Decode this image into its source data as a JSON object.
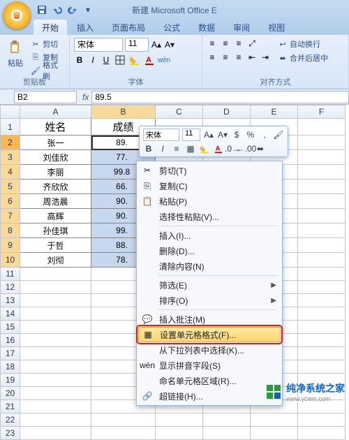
{
  "title": "新建 Microsoft Office E",
  "qat": {
    "save": "保存",
    "undo": "撤销",
    "redo": "重做"
  },
  "tabs": [
    "开始",
    "插入",
    "页面布局",
    "公式",
    "数据",
    "审阅",
    "视图"
  ],
  "active_tab_index": 0,
  "ribbon": {
    "clipboard": {
      "label": "剪贴板",
      "paste": "粘贴",
      "cut": "剪切",
      "copy": "复制",
      "format_painter": "格式刷"
    },
    "font": {
      "label": "字体",
      "name": "宋体",
      "size": "11"
    },
    "align": {
      "label": "对齐方式",
      "wrap": "自动换行",
      "merge": "合并后居中"
    }
  },
  "namebox": "B2",
  "formula": "89.5",
  "columns": [
    "A",
    "B",
    "C",
    "D",
    "E",
    "F"
  ],
  "row_headers": [
    1,
    2,
    3,
    4,
    5,
    6,
    7,
    8,
    9,
    10,
    11,
    12,
    13,
    14,
    15,
    16,
    17,
    18,
    19,
    20,
    21,
    22,
    23
  ],
  "header_row": {
    "A": "姓名",
    "B": "成绩"
  },
  "rows": [
    {
      "A": "张一",
      "B": "89."
    },
    {
      "A": "刘佳欣",
      "B": "77."
    },
    {
      "A": "李丽",
      "B": "99.8"
    },
    {
      "A": "齐欣欣",
      "B": "66."
    },
    {
      "A": "周浩晨",
      "B": "90."
    },
    {
      "A": "高辉",
      "B": "90."
    },
    {
      "A": "孙佳琪",
      "B": "99."
    },
    {
      "A": "于哲",
      "B": "88."
    },
    {
      "A": "刘彻",
      "B": "78."
    }
  ],
  "mini_toolbar": {
    "font": "宋体",
    "size": "11"
  },
  "context_menu": [
    {
      "icon": "scissors",
      "label": "剪切(T)"
    },
    {
      "icon": "copy",
      "label": "复制(C)"
    },
    {
      "icon": "paste",
      "label": "粘贴(P)"
    },
    {
      "icon": "",
      "label": "选择性粘贴(V)..."
    },
    {
      "sep": true
    },
    {
      "icon": "",
      "label": "插入(I)..."
    },
    {
      "icon": "",
      "label": "删除(D)..."
    },
    {
      "icon": "",
      "label": "清除内容(N)"
    },
    {
      "sep": true
    },
    {
      "icon": "",
      "label": "筛选(E)",
      "sub": true
    },
    {
      "icon": "",
      "label": "排序(O)",
      "sub": true
    },
    {
      "sep": true
    },
    {
      "icon": "comment",
      "label": "插入批注(M)"
    },
    {
      "icon": "format",
      "label": "设置单元格格式(F)...",
      "hl": true
    },
    {
      "icon": "",
      "label": "从下拉列表中选择(K)..."
    },
    {
      "icon": "pinyin",
      "label": "显示拼音字段(S)"
    },
    {
      "icon": "",
      "label": "命名单元格区域(R)..."
    },
    {
      "icon": "link",
      "label": "超链接(H)..."
    }
  ],
  "watermark": "纯净系统之家",
  "watermark_url": "www.ycwin.com",
  "colors": {
    "accent": "#2a6cc4",
    "selection": "#c7d7ed",
    "hl": "#ffd56b"
  }
}
